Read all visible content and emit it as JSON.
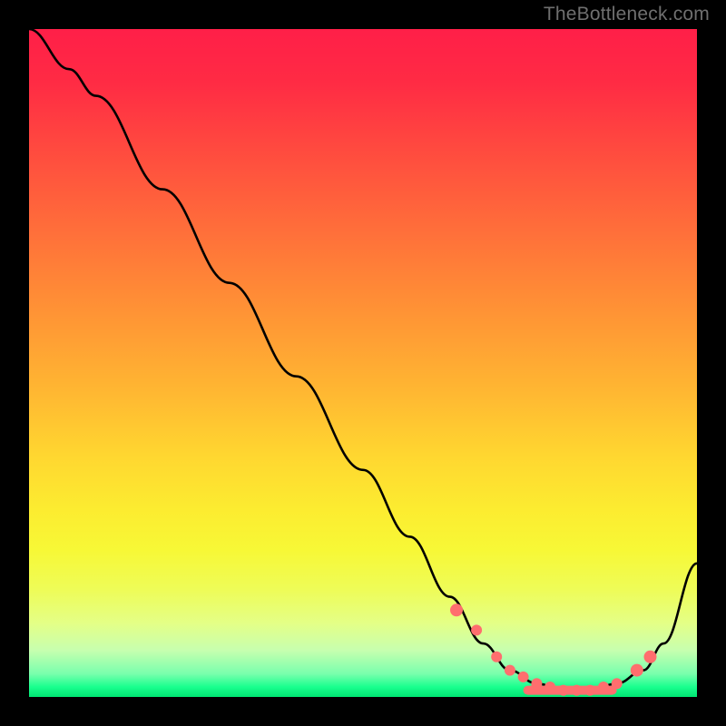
{
  "watermark": "TheBottleneck.com",
  "chart_data": {
    "type": "line",
    "title": "",
    "xlabel": "",
    "ylabel": "",
    "xlim": [
      0,
      100
    ],
    "ylim": [
      0,
      100
    ],
    "series": [
      {
        "name": "bottleneck-curve",
        "x": [
          0,
          6,
          10,
          20,
          30,
          40,
          50,
          57,
          63,
          68,
          72,
          76,
          80,
          84,
          88,
          92,
          95,
          100
        ],
        "y": [
          100,
          94,
          90,
          76,
          62,
          48,
          34,
          24,
          15,
          8,
          4,
          2,
          1,
          1,
          2,
          4,
          8,
          20
        ]
      }
    ],
    "markers": {
      "name": "optimal-range-dots",
      "x": [
        64,
        67,
        70,
        72,
        74,
        76,
        78,
        80,
        82,
        84,
        86,
        88,
        91,
        93
      ],
      "y": [
        13,
        10,
        6,
        4,
        3,
        2,
        1.5,
        1,
        1,
        1,
        1.5,
        2,
        4,
        6
      ]
    },
    "gradient_stops": [
      {
        "pos": 0,
        "color": "#ff1f48"
      },
      {
        "pos": 50,
        "color": "#ffb030"
      },
      {
        "pos": 80,
        "color": "#f7f836"
      },
      {
        "pos": 100,
        "color": "#00e572"
      }
    ]
  }
}
